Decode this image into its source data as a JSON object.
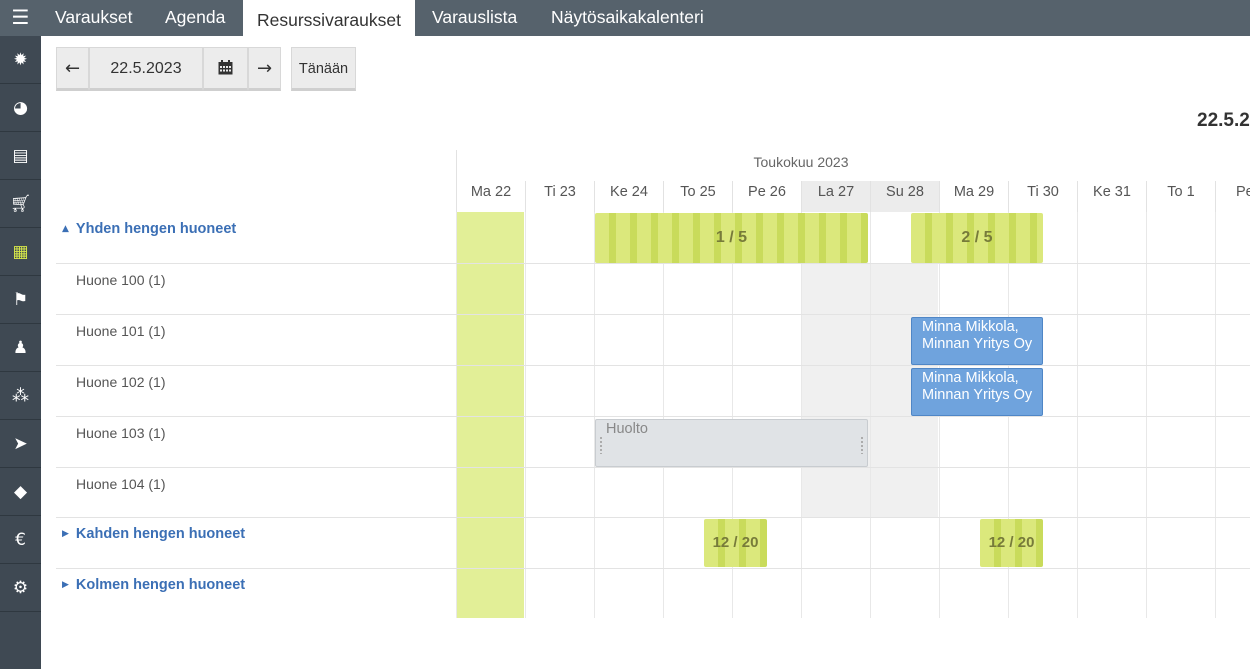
{
  "nav": {
    "menu_icon": "hamburger-menu-icon",
    "icons": [
      "sun-icon",
      "dashboard-icon",
      "book-icon",
      "cart-icon",
      "calendar-icon",
      "broom-icon",
      "person-icon",
      "boxes-icon",
      "send-icon",
      "tag-icon",
      "euro-icon",
      "gear-icon"
    ],
    "active_icon": "calendar-icon",
    "accent_color": "#d8e84a"
  },
  "tabs": [
    "Varaukset",
    "Agenda",
    "Resurssivaraukset",
    "Varauslista",
    "Näytösaikakalenteri"
  ],
  "active_tab": "Resurssivaraukset",
  "toolbar": {
    "prev_icon": "arrow-left-icon",
    "date": "22.5.2023",
    "calendar_icon": "calendar-icon",
    "next_icon": "arrow-right-icon",
    "today_label": "Tänään"
  },
  "big_date": "22.5.2",
  "calendar": {
    "month": "Toukokuu 2023",
    "days": [
      "Ma 22",
      "Ti 23",
      "Ke 24",
      "To 25",
      "Pe 26",
      "La 27",
      "Su 28",
      "Ma 29",
      "Ti 30",
      "Ke 31",
      "To 1",
      "Pe"
    ],
    "groups": [
      {
        "label": "Yhden hengen huoneet",
        "expanded": true,
        "caret_icon": "caret-up-icon"
      },
      {
        "label": "Kahden hengen huoneet",
        "expanded": false,
        "caret_icon": "caret-right-icon"
      },
      {
        "label": "Kolmen hengen huoneet",
        "expanded": false,
        "caret_icon": "caret-right-icon"
      }
    ],
    "rooms": [
      "Huone 100 (1)",
      "Huone 101 (1)",
      "Huone 102 (1)",
      "Huone 103 (1)",
      "Huone 104 (1)"
    ],
    "occupancy": [
      {
        "group": "Yhden hengen huoneet",
        "text": "1 / 5"
      },
      {
        "group": "Yhden hengen huoneet",
        "text": "2 / 5"
      },
      {
        "group": "Kahden hengen huoneet",
        "text": "12 / 20"
      },
      {
        "group": "Kahden hengen huoneet",
        "text": "12 / 20"
      }
    ],
    "reservations": [
      {
        "room": "Huone 101 (1)",
        "line1": "Minna Mikkola,",
        "line2": "Minnan Yritys Oy"
      },
      {
        "room": "Huone 102 (1)",
        "line1": "Minna Mikkola,",
        "line2": "Minnan Yritys Oy"
      }
    ],
    "maintenance": {
      "room": "Huone 103 (1)",
      "label": "Huolto"
    },
    "colors": {
      "today": "#e2ef97",
      "occupancy": "#dbe87c",
      "reservation": "#6fa3dd",
      "maintenance": "#e0e3e6",
      "group_label": "#3b6fb5"
    }
  }
}
